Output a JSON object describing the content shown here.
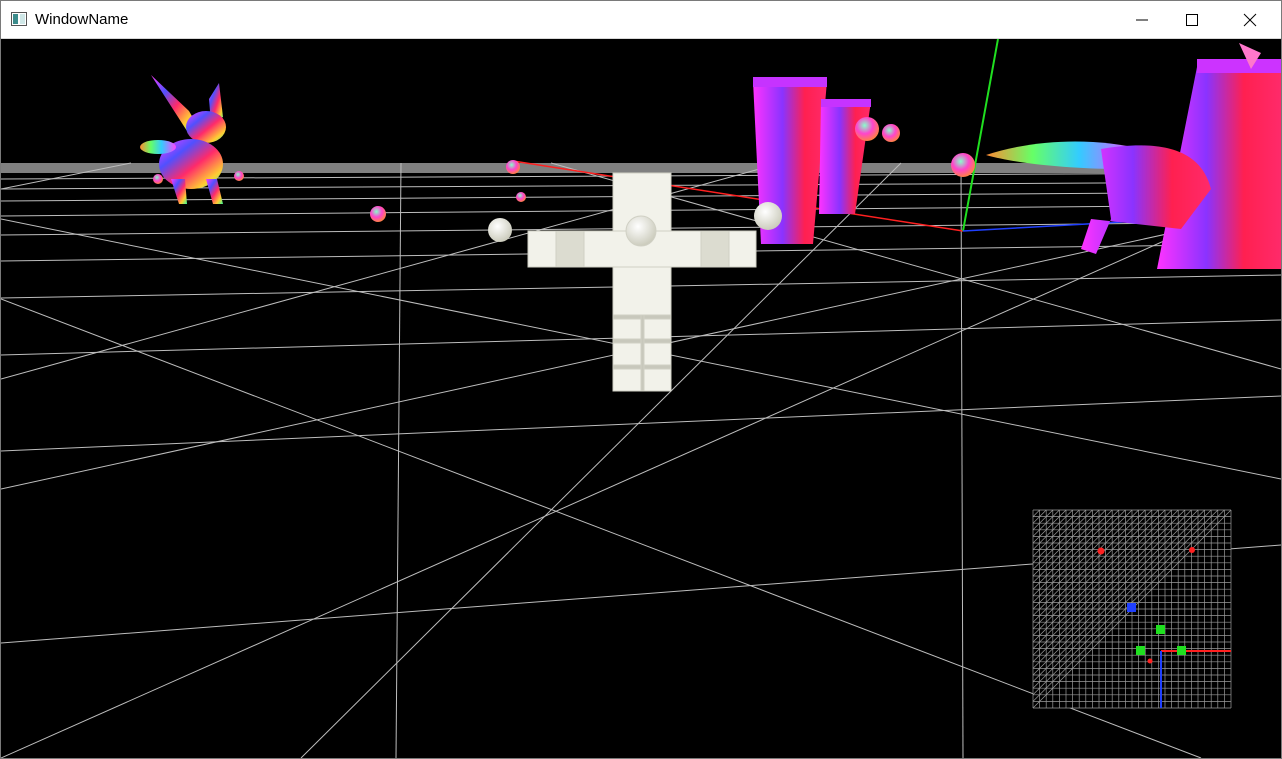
{
  "window": {
    "title": "WindowName",
    "controls": {
      "minimize": "minimize",
      "maximize": "maximize",
      "close": "close"
    }
  },
  "scene": {
    "background": "#000000",
    "grid_color": "#c8c8c8",
    "horizon_color": "#808080",
    "axis_colors": {
      "x": "#ff2020",
      "y": "#20e020",
      "z": "#2040ff"
    },
    "objects": [
      "bunny-model",
      "castle-tower",
      "character-model",
      "sphere",
      "sphere",
      "sphere"
    ]
  },
  "minimap": {
    "grid_color": "#9a9a9a",
    "markers": [
      "red",
      "red",
      "blue",
      "green",
      "green",
      "green",
      "red"
    ]
  }
}
